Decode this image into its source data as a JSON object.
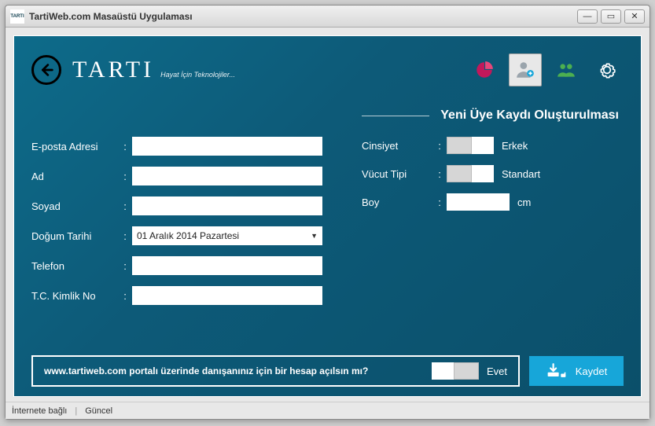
{
  "window": {
    "title": "TartiWeb.com Masaüstü Uygulaması"
  },
  "logo": {
    "text": "TARTI",
    "tagline": "Hayat İçin Teknolojiler..."
  },
  "section": {
    "title": "Yeni Üye Kaydı Oluşturulması"
  },
  "form": {
    "email_label": "E-posta Adresi",
    "email_value": "",
    "name_label": "Ad",
    "name_value": "",
    "surname_label": "Soyad",
    "surname_value": "",
    "birth_label": "Doğum Tarihi",
    "birth_value": "01  Aralık  2014 Pazartesi",
    "phone_label": "Telefon",
    "phone_value": "",
    "tckn_label": "T.C. Kimlik No",
    "tckn_value": "",
    "gender_label": "Cinsiyet",
    "gender_value": "Erkek",
    "body_label": "Vücut Tipi",
    "body_value": "Standart",
    "height_label": "Boy",
    "height_value": "",
    "height_unit": "cm"
  },
  "question": {
    "text": "www.tartiweb.com portalı üzerinde danışanınız için bir hesap açılsın mı?",
    "answer": "Evet"
  },
  "save_label": "Kaydet",
  "statusbar": {
    "connection": "İnternete bağlı",
    "version": "Güncel"
  },
  "colors": {
    "accent": "#17a6d9",
    "magenta": "#c2185b",
    "green": "#4caf50"
  }
}
